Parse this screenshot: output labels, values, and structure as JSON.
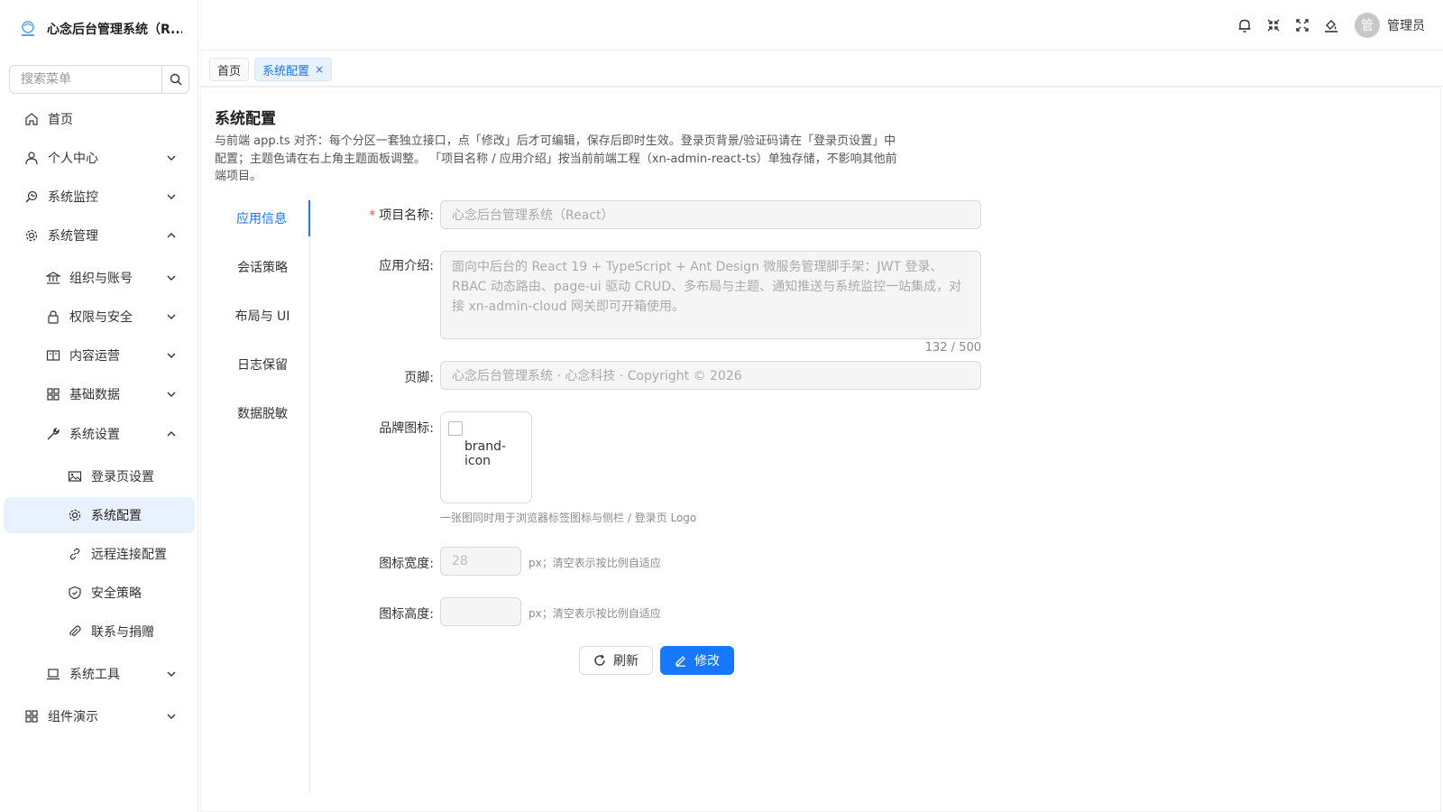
{
  "brand": {
    "title": "心念后台管理系统（R...",
    "logo_icon": "brand-logo-icon"
  },
  "sidebar": {
    "search_placeholder": "搜索菜单",
    "items": [
      {
        "label": "首页",
        "icon": "home-icon"
      },
      {
        "label": "个人中心",
        "icon": "user-icon"
      },
      {
        "label": "系统监控",
        "icon": "monitor-icon"
      },
      {
        "label": "系统管理",
        "icon": "gear-icon"
      },
      {
        "label": "组织与账号",
        "icon": "bank-icon"
      },
      {
        "label": "权限与安全",
        "icon": "lock-icon"
      },
      {
        "label": "内容运营",
        "icon": "book-icon"
      },
      {
        "label": "基础数据",
        "icon": "grid-icon"
      },
      {
        "label": "系统设置",
        "icon": "wrench-icon"
      },
      {
        "label": "登录页设置",
        "icon": "image-icon"
      },
      {
        "label": "系统配置",
        "icon": "gear-icon"
      },
      {
        "label": "远程连接配置",
        "icon": "link-icon"
      },
      {
        "label": "安全策略",
        "icon": "shield-icon"
      },
      {
        "label": "联系与捐赠",
        "icon": "paperclip-icon"
      },
      {
        "label": "系统工具",
        "icon": "laptop-icon"
      },
      {
        "label": "组件演示",
        "icon": "grid-icon"
      }
    ]
  },
  "header": {
    "avatar_text": "管",
    "user_name": "管理员"
  },
  "tabs": [
    {
      "label": "首页"
    },
    {
      "label": "系统配置",
      "close": "×"
    }
  ],
  "page": {
    "title": "系统配置",
    "description": "与前端 app.ts 对齐：每个分区一套独立接口，点「修改」后才可编辑，保存后即时生效。登录页背景/验证码请在「登录页设置」中配置；主题色请在右上角主题面板调整。 「项目名称 / 应用介绍」按当前前端工程（xn-admin-react-ts）单独存储，不影响其他前端项目。"
  },
  "vtabs": [
    "应用信息",
    "会话策略",
    "布局与 UI",
    "日志保留",
    "数据脱敏"
  ],
  "form": {
    "project_name_label": "项目名称:",
    "project_name_value": "心念后台管理系统（React）",
    "intro_label": "应用介绍:",
    "intro_value": "面向中后台的 React 19 + TypeScript + Ant Design 微服务管理脚手架：JWT 登录、RBAC 动态路由、page-ui 驱动 CRUD、多布局与主题、通知推送与系统监控一站集成，对接 xn-admin-cloud 网关即可开箱使用。",
    "intro_counter": "132 / 500",
    "footer_label": "页脚:",
    "footer_value": "心念后台管理系统 · 心念科技 · Copyright © 2026",
    "brand_icon_label": "品牌图标:",
    "brand_icon_alt": "brand-icon",
    "brand_icon_hint": "一张图同时用于浏览器标签图标与侧栏 / 登录页 Logo",
    "icon_width_label": "图标宽度:",
    "icon_width_value": "28",
    "icon_width_hint": "px；清空表示按比例自适应",
    "icon_height_label": "图标高度:",
    "icon_height_value": "",
    "icon_height_hint": "px；清空表示按比例自适应"
  },
  "buttons": {
    "refresh": "刷新",
    "edit": "修改"
  },
  "colors": {
    "primary": "#1677ff",
    "active_bg": "#e8f1ff",
    "required": "#ff4d4f"
  }
}
